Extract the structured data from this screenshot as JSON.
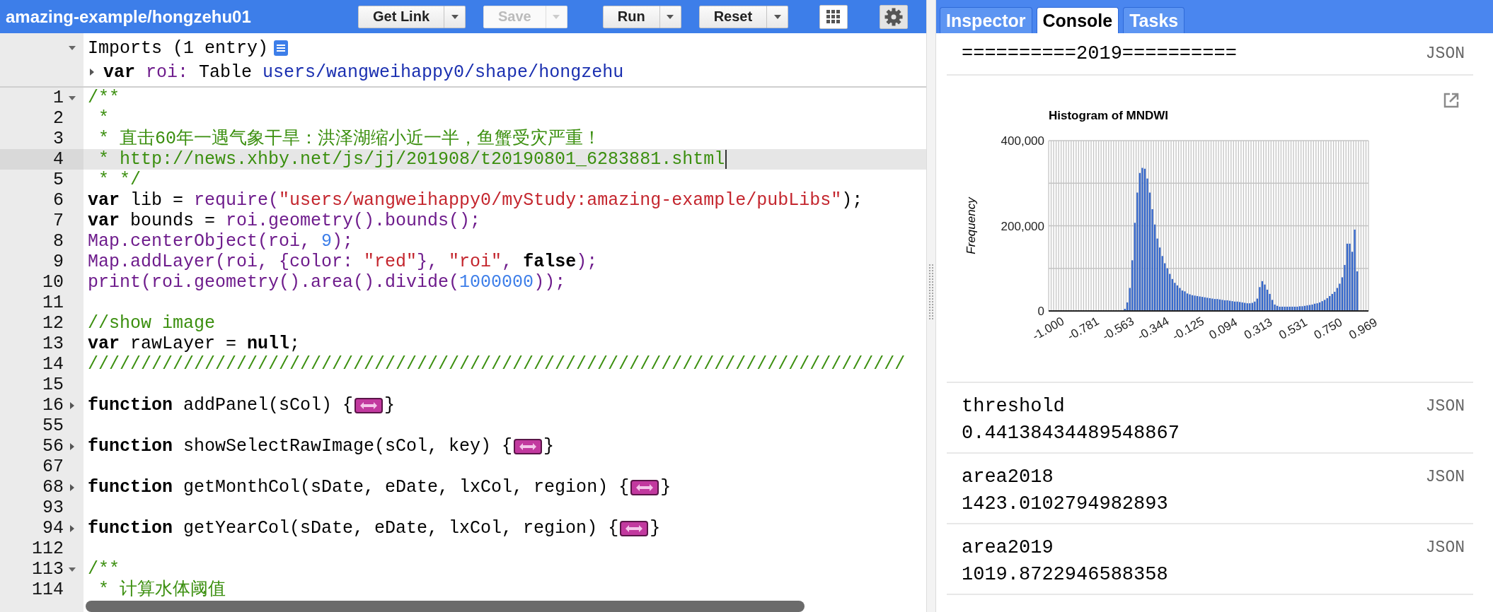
{
  "editor": {
    "title": "amazing-example/hongzehu01",
    "buttons": [
      {
        "label": "Get Link",
        "disabled": false
      },
      {
        "label": "Save",
        "disabled": true
      },
      {
        "label": "Run",
        "disabled": false
      },
      {
        "label": "Reset",
        "disabled": false
      }
    ],
    "imports": {
      "header": "Imports (1 entry)",
      "expanded": true,
      "entries": [
        {
          "expanded": false,
          "tokens": [
            {
              "kind": "keyword",
              "text": "var"
            },
            {
              "kind": "call",
              "text": " roi:"
            },
            {
              "kind": "plain",
              "text": " Table "
            },
            {
              "kind": "path",
              "text": "users/wangweihappy0/shape/hongzehu"
            }
          ]
        }
      ]
    },
    "lines": [
      {
        "number": "1",
        "expanded": true,
        "highlighted": false,
        "tokens": [
          {
            "kind": "comment",
            "text": "/**"
          }
        ]
      },
      {
        "number": "2",
        "highlighted": false,
        "tokens": [
          {
            "kind": "comment",
            "text": " *"
          }
        ]
      },
      {
        "number": "3",
        "highlighted": false,
        "tokens": [
          {
            "kind": "comment",
            "text": " * 直击60年一遇气象干旱：洪泽湖缩小近一半，鱼蟹受灾严重！"
          }
        ]
      },
      {
        "number": "4",
        "highlighted": true,
        "tokens": [
          {
            "kind": "comment",
            "text": " * http://news.xhby.net/js/jj/201908/t20190801_6283881.shtml"
          }
        ]
      },
      {
        "number": "5",
        "highlighted": false,
        "tokens": [
          {
            "kind": "comment",
            "text": " * */"
          }
        ]
      },
      {
        "number": "6",
        "highlighted": false,
        "tokens": [
          {
            "kind": "keyword",
            "text": "var"
          },
          {
            "kind": "plain",
            "text": " lib = "
          },
          {
            "kind": "call",
            "text": "require("
          },
          {
            "kind": "string",
            "text": "\"users/wangweihappy0/myStudy:amazing-example/pubLibs\""
          },
          {
            "kind": "plain",
            "text": ");"
          }
        ]
      },
      {
        "number": "7",
        "highlighted": false,
        "tokens": [
          {
            "kind": "keyword",
            "text": "var"
          },
          {
            "kind": "plain",
            "text": " bounds = "
          },
          {
            "kind": "call",
            "text": "roi.geometry().bounds();"
          }
        ]
      },
      {
        "number": "8",
        "highlighted": false,
        "tokens": [
          {
            "kind": "call",
            "text": "Map.centerObject(roi, "
          },
          {
            "kind": "number",
            "text": "9"
          },
          {
            "kind": "call",
            "text": ");"
          }
        ]
      },
      {
        "number": "9",
        "highlighted": false,
        "tokens": [
          {
            "kind": "call",
            "text": "Map.addLayer(roi, {color: "
          },
          {
            "kind": "string",
            "text": "\"red\""
          },
          {
            "kind": "call",
            "text": "}, "
          },
          {
            "kind": "string",
            "text": "\"roi\""
          },
          {
            "kind": "call",
            "text": ", "
          },
          {
            "kind": "keyword",
            "text": "false"
          },
          {
            "kind": "call",
            "text": ");"
          }
        ]
      },
      {
        "number": "10",
        "highlighted": false,
        "tokens": [
          {
            "kind": "call",
            "text": "print(roi.geometry().area().divide("
          },
          {
            "kind": "number",
            "text": "1000000"
          },
          {
            "kind": "call",
            "text": "));"
          }
        ]
      },
      {
        "number": "11",
        "highlighted": false
      },
      {
        "number": "12",
        "highlighted": false,
        "tokens": [
          {
            "kind": "comment",
            "text": "//show image"
          }
        ]
      },
      {
        "number": "13",
        "highlighted": false,
        "tokens": [
          {
            "kind": "keyword",
            "text": "var"
          },
          {
            "kind": "plain",
            "text": " rawLayer = "
          },
          {
            "kind": "keyword",
            "text": "null"
          },
          {
            "kind": "plain",
            "text": ";"
          }
        ]
      },
      {
        "number": "14",
        "highlighted": false,
        "tokens": [
          {
            "kind": "comment",
            "text": "/////////////////////////////////////////////////////////////////////////////"
          }
        ]
      },
      {
        "number": "15",
        "highlighted": false
      },
      {
        "number": "16",
        "expanded": false,
        "highlighted": false,
        "tokens": [
          {
            "kind": "keyword",
            "text": "function"
          },
          {
            "kind": "plain",
            "text": " addPanel(sCol) {"
          },
          {
            "kind": "fold"
          },
          {
            "kind": "plain",
            "text": "}"
          }
        ]
      },
      {
        "number": "55",
        "highlighted": false
      },
      {
        "number": "56",
        "expanded": false,
        "highlighted": false,
        "tokens": [
          {
            "kind": "keyword",
            "text": "function"
          },
          {
            "kind": "plain",
            "text": " showSelectRawImage(sCol, key) {"
          },
          {
            "kind": "fold"
          },
          {
            "kind": "plain",
            "text": "}"
          }
        ]
      },
      {
        "number": "67",
        "highlighted": false
      },
      {
        "number": "68",
        "expanded": false,
        "highlighted": false,
        "tokens": [
          {
            "kind": "keyword",
            "text": "function"
          },
          {
            "kind": "plain",
            "text": " getMonthCol(sDate, eDate, lxCol, region) {"
          },
          {
            "kind": "fold"
          },
          {
            "kind": "plain",
            "text": "}"
          }
        ]
      },
      {
        "number": "93",
        "highlighted": false
      },
      {
        "number": "94",
        "expanded": false,
        "highlighted": false,
        "tokens": [
          {
            "kind": "keyword",
            "text": "function"
          },
          {
            "kind": "plain",
            "text": " getYearCol(sDate, eDate, lxCol, region) {"
          },
          {
            "kind": "fold"
          },
          {
            "kind": "plain",
            "text": "}"
          }
        ]
      },
      {
        "number": "112",
        "highlighted": false
      },
      {
        "number": "113",
        "expanded": true,
        "highlighted": false,
        "tokens": [
          {
            "kind": "comment",
            "text": "/**"
          }
        ]
      },
      {
        "number": "114",
        "highlighted": false,
        "tokens": [
          {
            "kind": "comment",
            "text": " * 计算水体阈值"
          }
        ]
      }
    ]
  },
  "panel": {
    "tabs": [
      {
        "label": "Inspector",
        "selected": false
      },
      {
        "label": "Console",
        "selected": true
      },
      {
        "label": "Tasks",
        "selected": false
      }
    ],
    "console": [
      {
        "kind": "text",
        "text": "==========2019==========",
        "link": "JSON"
      },
      {
        "kind": "chart",
        "chart_data": {
          "type": "bar",
          "title": "Histogram of MNDWI",
          "ylabel": "Frequency",
          "grid": true,
          "xlim": [
            -1,
            1
          ],
          "ylim": [
            0,
            400000
          ],
          "x": [
            -1,
            -0.984375,
            -0.96875,
            -0.953125,
            -0.9375,
            -0.921875,
            -0.90625,
            -0.890625,
            -0.875,
            -0.859375,
            -0.84375,
            -0.828125,
            -0.8125,
            -0.796875,
            -0.78125,
            -0.765625,
            -0.75,
            -0.734375,
            -0.71875,
            -0.703125,
            -0.6875,
            -0.671875,
            -0.65625,
            -0.640625,
            -0.625,
            -0.609375,
            -0.59375,
            -0.578125,
            -0.5625,
            -0.546875,
            -0.53125,
            -0.515625,
            -0.5,
            -0.484375,
            -0.46875,
            -0.453125,
            -0.4375,
            -0.421875,
            -0.40625,
            -0.390625,
            -0.375,
            -0.359375,
            -0.34375,
            -0.328125,
            -0.3125,
            -0.296875,
            -0.28125,
            -0.265625,
            -0.25,
            -0.234375,
            -0.21875,
            -0.203125,
            -0.1875,
            -0.171875,
            -0.15625,
            -0.140625,
            -0.125,
            -0.109375,
            -0.09375,
            -0.078125,
            -0.0625,
            -0.046875,
            -0.03125,
            -0.015625,
            0,
            0.015625,
            0.03125,
            0.046875,
            0.0625,
            0.078125,
            0.09375,
            0.109375,
            0.125,
            0.140625,
            0.15625,
            0.171875,
            0.1875,
            0.203125,
            0.21875,
            0.234375,
            0.25,
            0.265625,
            0.28125,
            0.296875,
            0.3125,
            0.328125,
            0.34375,
            0.359375,
            0.375,
            0.390625,
            0.40625,
            0.421875,
            0.4375,
            0.453125,
            0.46875,
            0.484375,
            0.5,
            0.515625,
            0.53125,
            0.546875,
            0.5625,
            0.578125,
            0.59375,
            0.609375,
            0.625,
            0.640625,
            0.65625,
            0.671875,
            0.6875,
            0.703125,
            0.71875,
            0.734375,
            0.75,
            0.765625,
            0.78125,
            0.796875,
            0.8125,
            0.828125,
            0.84375,
            0.859375,
            0.875,
            0.890625,
            0.90625,
            0.921875,
            0.9375,
            0.953125,
            0.96875,
            0.984375
          ],
          "xticks": [
            {
              "value": -1,
              "label": "-1.000"
            },
            {
              "value": -0.78125,
              "label": "-0.781"
            },
            {
              "value": -0.5625,
              "label": "-0.563"
            },
            {
              "value": -0.34375,
              "label": "-0.344"
            },
            {
              "value": -0.125,
              "label": "-0.125"
            },
            {
              "value": 0.09375,
              "label": "0.094"
            },
            {
              "value": 0.3125,
              "label": "0.313"
            },
            {
              "value": 0.53125,
              "label": "0.531"
            },
            {
              "value": 0.75,
              "label": "0.750"
            },
            {
              "value": 0.96875,
              "label": "0.969"
            }
          ],
          "yticks": [
            {
              "value": 0,
              "label": "0"
            },
            {
              "value": 200000,
              "label": "200,000"
            },
            {
              "value": 400000,
              "label": "400,000"
            }
          ],
          "series": [
            {
              "color": "#3366cc",
              "values": [
                0,
                0,
                0,
                0,
                0,
                0,
                0,
                0,
                0,
                0,
                0,
                0,
                0,
                0,
                0,
                0,
                0,
                0,
                0,
                0,
                0,
                0,
                0,
                0,
                0,
                0,
                0,
                0,
                0,
                0,
                5000,
                20000,
                54000,
                119000,
                207000,
                278000,
                324000,
                336000,
                334000,
                311000,
                278000,
                239000,
                203000,
                170000,
                149000,
                129000,
                112000,
                100000,
                87000,
                75000,
                66000,
                60000,
                54000,
                48000,
                46000,
                41000,
                39000,
                37000,
                36000,
                35000,
                34000,
                33000,
                32000,
                31000,
                30000,
                29000,
                28000,
                28000,
                27000,
                26000,
                25000,
                25000,
                24000,
                23000,
                22000,
                22000,
                21000,
                20000,
                19000,
                18000,
                18000,
                19000,
                22000,
                29000,
                56000,
                70000,
                62000,
                50000,
                40000,
                26000,
                15000,
                12000,
                10000,
                10000,
                10000,
                10000,
                10000,
                10000,
                10000,
                10000,
                11000,
                11000,
                12000,
                13000,
                14000,
                15000,
                17000,
                18000,
                20000,
                23000,
                26000,
                30000,
                35000,
                40000,
                45000,
                54000,
                64000,
                79000,
                108000,
                158000,
                158000,
                139000,
                191000,
                93000,
                0,
                0,
                0,
                0
              ]
            }
          ]
        }
      },
      {
        "kind": "value",
        "label": "threshold",
        "value": "0.44138434489548867",
        "link": "JSON"
      },
      {
        "kind": "value",
        "label": "area2018",
        "value": "1423.0102794982893",
        "link": "JSON"
      },
      {
        "kind": "value",
        "label": "area2019",
        "value": "1019.8722946588358",
        "link": "JSON"
      }
    ]
  }
}
